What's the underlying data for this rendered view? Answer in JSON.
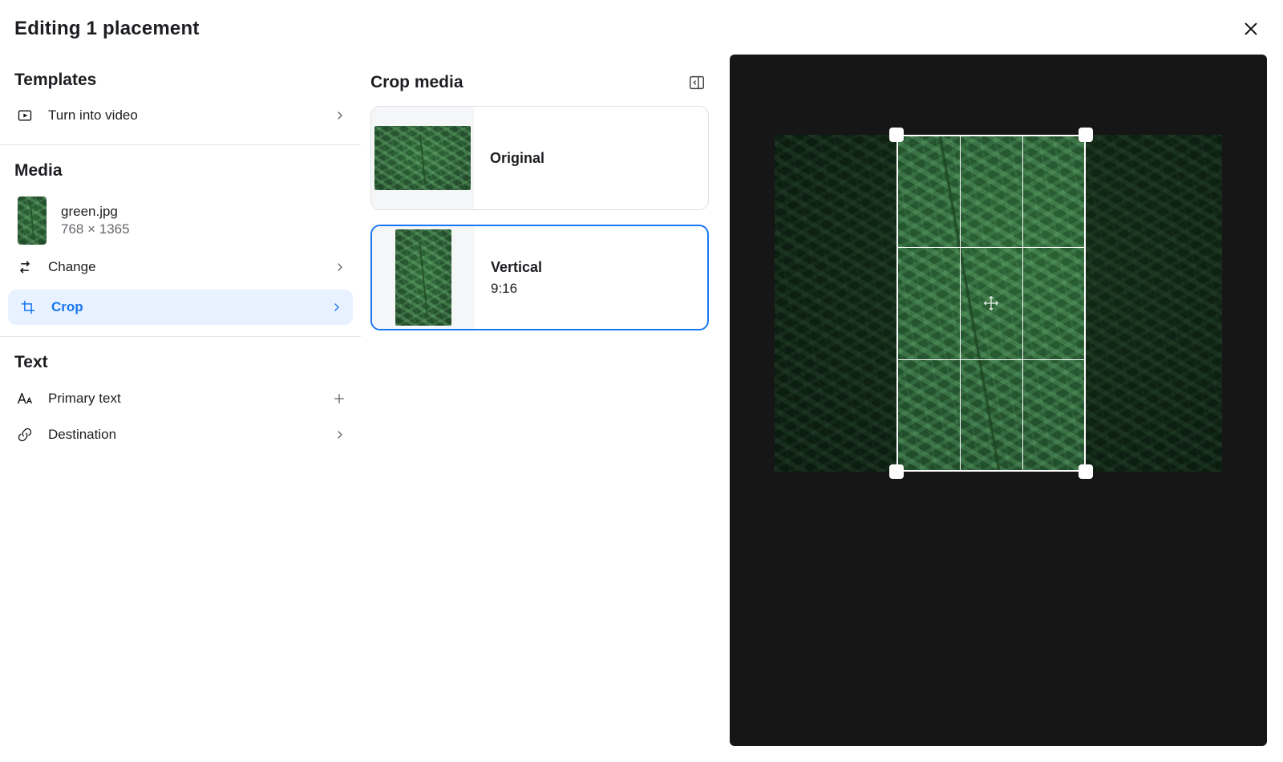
{
  "header": {
    "title": "Editing 1 placement"
  },
  "accent_color": "#1877f2",
  "sidebar": {
    "templates": {
      "title": "Templates",
      "turn_into_video": "Turn into video"
    },
    "media": {
      "title": "Media",
      "file": {
        "name": "green.jpg",
        "dimensions": "768 × 1365"
      },
      "change_label": "Change",
      "crop_label": "Crop"
    },
    "text_section": {
      "title": "Text",
      "primary_text": "Primary text",
      "destination": "Destination"
    }
  },
  "crop": {
    "title": "Crop media",
    "options": [
      {
        "name": "Original",
        "ratio": ""
      },
      {
        "name": "Vertical",
        "ratio": "9:16"
      }
    ],
    "selected_index": 1
  }
}
